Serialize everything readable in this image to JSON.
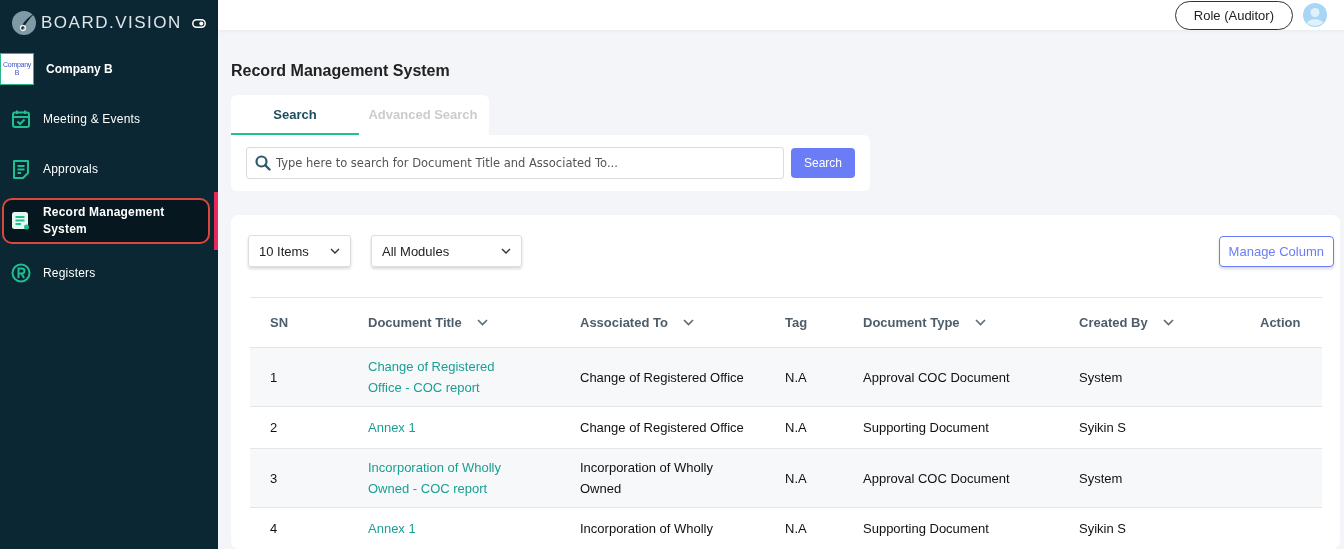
{
  "brand": {
    "name": "BOARD.VISION"
  },
  "company": {
    "logo_text": "Company B",
    "name": "Company B"
  },
  "sidebar": {
    "items": [
      {
        "label": "Meeting & Events",
        "kind": "calendar",
        "selected": false
      },
      {
        "label": "Approvals",
        "kind": "document",
        "selected": false
      },
      {
        "label": "Record Management System",
        "kind": "record",
        "selected": true
      },
      {
        "label": "Registers",
        "kind": "registered",
        "selected": false
      }
    ]
  },
  "header": {
    "role_button": "Role (Auditor)"
  },
  "page_title": "Record Management System",
  "tabs": [
    {
      "label": "Search",
      "selected": true
    },
    {
      "label": "Advanced Search",
      "selected": false
    }
  ],
  "search": {
    "placeholder": "Type here to search for Document Title and Associated To...",
    "button": "Search"
  },
  "filters": [
    {
      "value": "10 Items"
    },
    {
      "value": "All Modules"
    }
  ],
  "manage_column_button": "Manage Column",
  "table": {
    "columns": [
      {
        "label": "SN",
        "sortable": false
      },
      {
        "label": "Document Title",
        "sortable": true
      },
      {
        "label": "Associated To",
        "sortable": true
      },
      {
        "label": "Tag",
        "sortable": false
      },
      {
        "label": "Document Type",
        "sortable": true
      },
      {
        "label": "Created By",
        "sortable": true
      },
      {
        "label": "Action",
        "sortable": false
      }
    ],
    "rows": [
      {
        "sn": "1",
        "title": "Change of Registered Office - COC report",
        "associated": "Change of Registered Office",
        "tag": "N.A",
        "type": "Approval COC Document",
        "created_by": "System"
      },
      {
        "sn": "2",
        "title": "Annex 1",
        "associated": "Change of Registered Office",
        "tag": "N.A",
        "type": "Supporting Document",
        "created_by": "Syikin S"
      },
      {
        "sn": "3",
        "title": "Incorporation of Wholly Owned - COC report",
        "associated": "Incorporation of Wholly Owned",
        "tag": "N.A",
        "type": "Approval COC Document",
        "created_by": "System"
      },
      {
        "sn": "4",
        "title": "Annex 1",
        "associated": "Incorporation of Wholly",
        "tag": "N.A",
        "type": "Supporting Document",
        "created_by": "Syikin S"
      }
    ]
  }
}
